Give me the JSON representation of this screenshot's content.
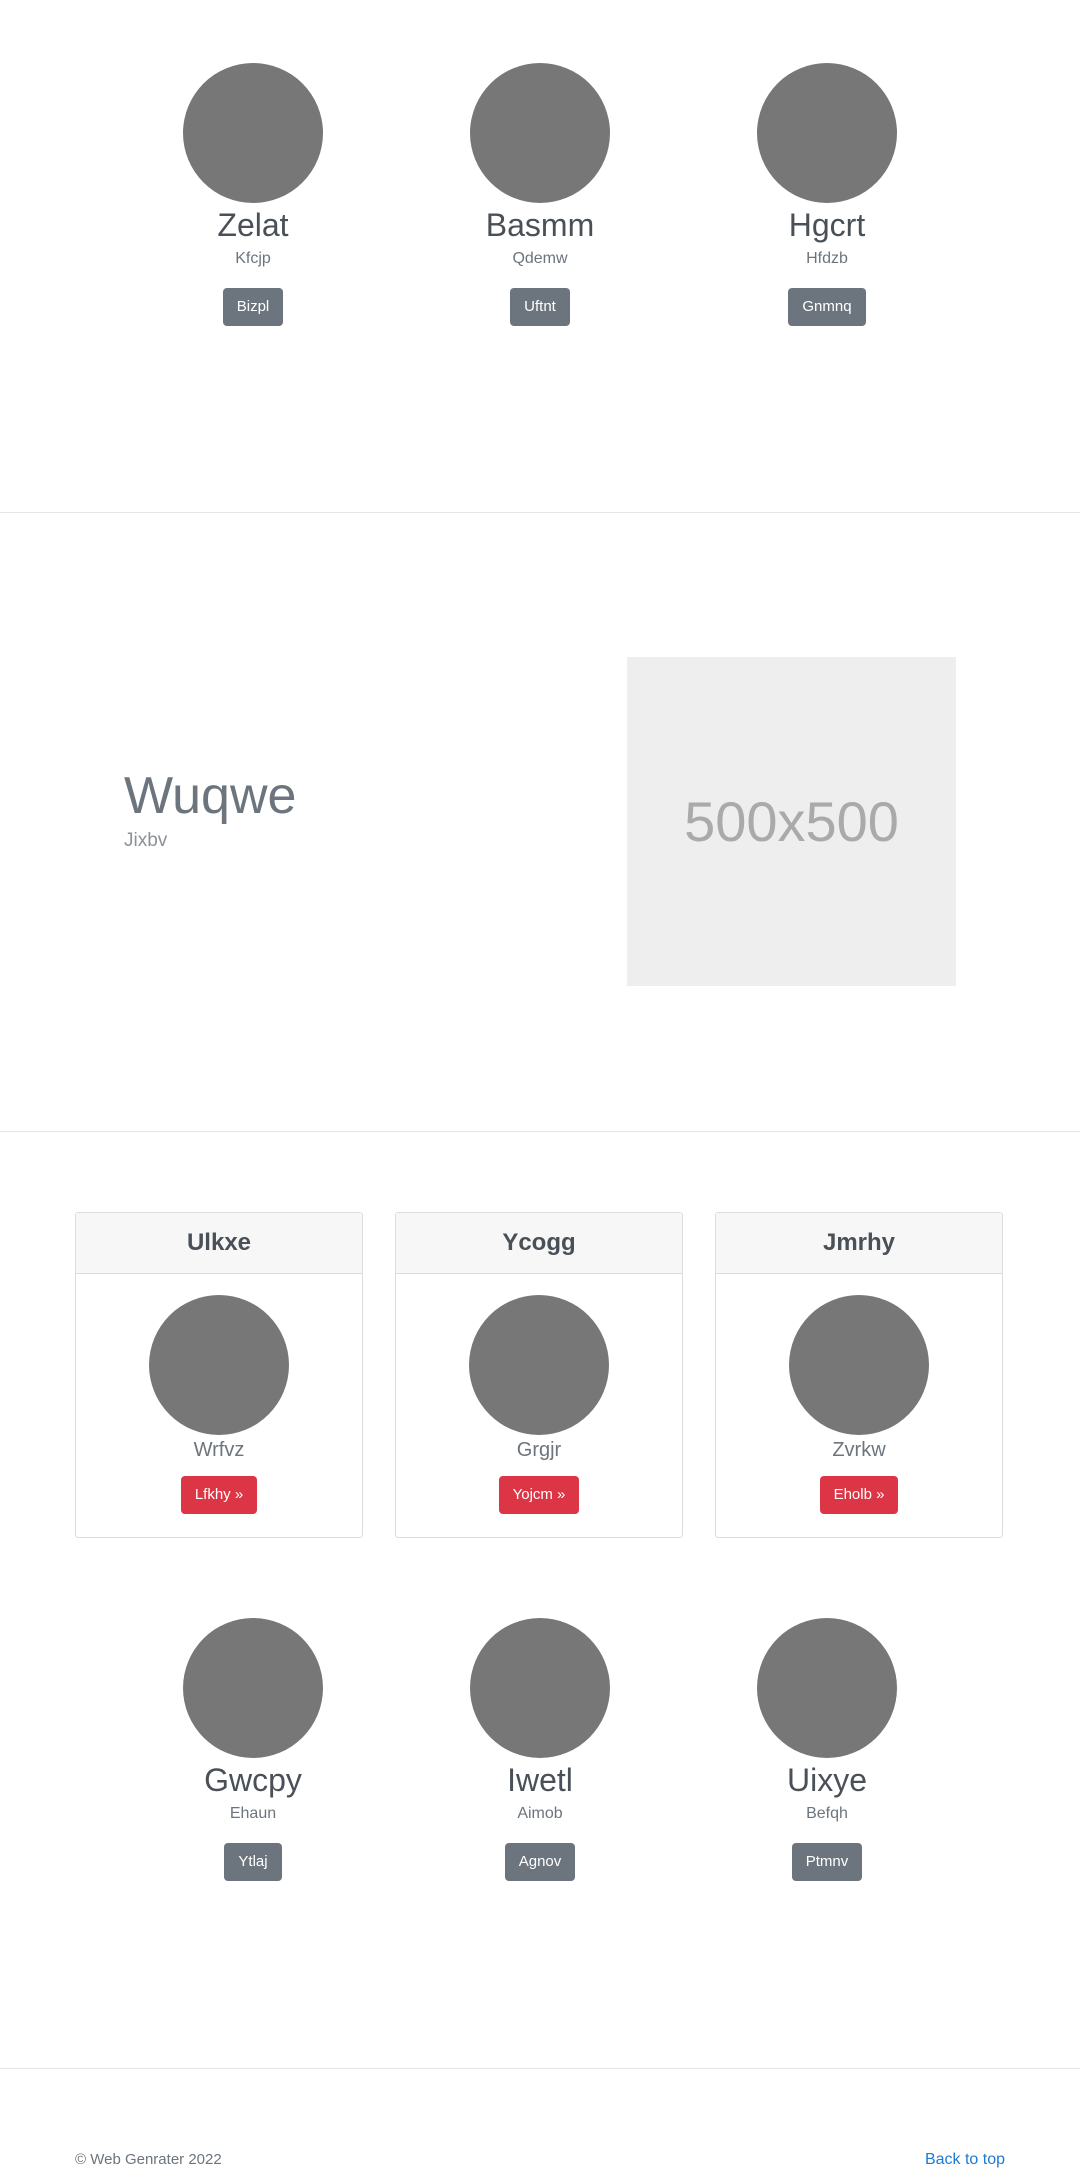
{
  "team_top": [
    {
      "name": "Zelat",
      "subtitle": "Kfcjp",
      "button": "Bizpl"
    },
    {
      "name": "Basmm",
      "subtitle": "Qdemw",
      "button": "Uftnt"
    },
    {
      "name": "Hgcrt",
      "subtitle": "Hfdzb",
      "button": "Gnmnq"
    }
  ],
  "feature": {
    "heading": "Wuqwe",
    "subheading": "Jixbv",
    "image_placeholder": "500x500"
  },
  "cards": [
    {
      "header": "Ulkxe",
      "subtitle": "Wrfvz",
      "button": "Lfkhy »"
    },
    {
      "header": "Ycogg",
      "subtitle": "Grgjr",
      "button": "Yojcm »"
    },
    {
      "header": "Jmrhy",
      "subtitle": "Zvrkw",
      "button": "Eholb »"
    }
  ],
  "team_bottom": [
    {
      "name": "Gwcpy",
      "subtitle": "Ehaun",
      "button": "Ytlaj"
    },
    {
      "name": "Iwetl",
      "subtitle": "Aimob",
      "button": "Agnov"
    },
    {
      "name": "Uixye",
      "subtitle": "Befqh",
      "button": "Ptmnv"
    }
  ],
  "footer": {
    "copyright": "© Web Genrater 2022",
    "back_to_top": "Back to top"
  },
  "colors": {
    "avatar": "#777777",
    "secondary_button": "#6c757d",
    "danger_button": "#dc3545",
    "link": "#1c7ad4"
  }
}
